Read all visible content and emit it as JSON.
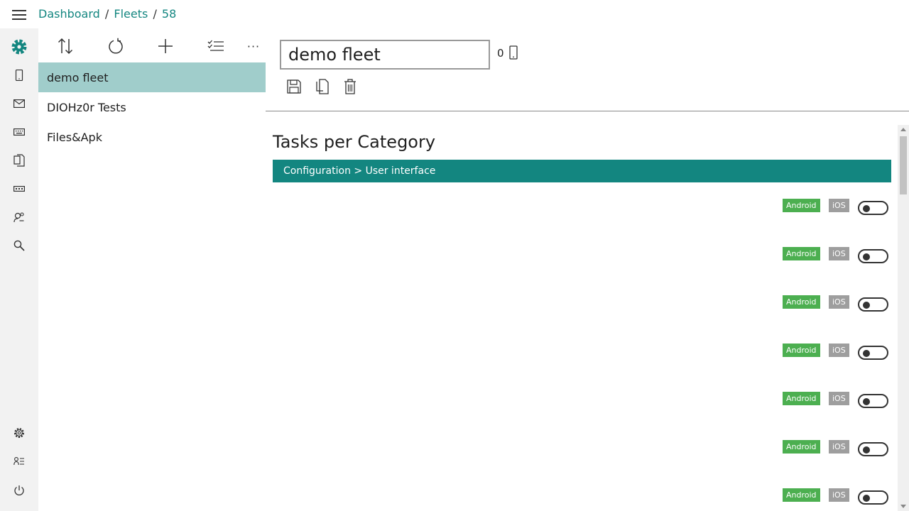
{
  "breadcrumb": {
    "dashboard": "Dashboard",
    "fleets": "Fleets",
    "current": "58",
    "separator": "/"
  },
  "rail": {
    "items": [
      {
        "icon": "fleets-gear-icon",
        "active": true
      },
      {
        "icon": "device-icon"
      },
      {
        "icon": "mail-icon"
      },
      {
        "icon": "keyboard-icon"
      },
      {
        "icon": "files-icon"
      },
      {
        "icon": "license-icon"
      },
      {
        "icon": "users-icon"
      },
      {
        "icon": "search-icon"
      }
    ],
    "bottom": [
      {
        "icon": "settings-icon"
      },
      {
        "icon": "account-list-icon"
      },
      {
        "icon": "power-icon"
      }
    ]
  },
  "toolbar": {
    "icons": [
      "sort-icon",
      "refresh-icon",
      "add-icon",
      "checklist-icon",
      "more-icon"
    ],
    "more_label": "···"
  },
  "fleets": [
    {
      "name": "demo fleet",
      "selected": true
    },
    {
      "name": "DIOHz0r Tests"
    },
    {
      "name": "Files&Apk"
    }
  ],
  "detail": {
    "fleet_name": "demo fleet",
    "device_count": "0",
    "actions": [
      "save-icon",
      "copy-icon",
      "delete-icon"
    ]
  },
  "tasks": {
    "title": "Tasks per Category",
    "category": "Configuration > User interface",
    "rows": [
      {
        "android": "Android",
        "ios": "iOS",
        "enabled": false
      },
      {
        "android": "Android",
        "ios": "iOS",
        "enabled": false
      },
      {
        "android": "Android",
        "ios": "iOS",
        "enabled": false
      },
      {
        "android": "Android",
        "ios": "iOS",
        "enabled": false
      },
      {
        "android": "Android",
        "ios": "iOS",
        "enabled": false
      },
      {
        "android": "Android",
        "ios": "iOS",
        "enabled": false
      },
      {
        "android": "Android",
        "ios": "iOS",
        "enabled": false
      }
    ]
  },
  "colors": {
    "accent": "#138680",
    "selected_row": "#a0cdcb",
    "android_badge": "#4caf50",
    "ios_badge": "#9e9e9e",
    "rail_bg": "#f2f2f2"
  }
}
